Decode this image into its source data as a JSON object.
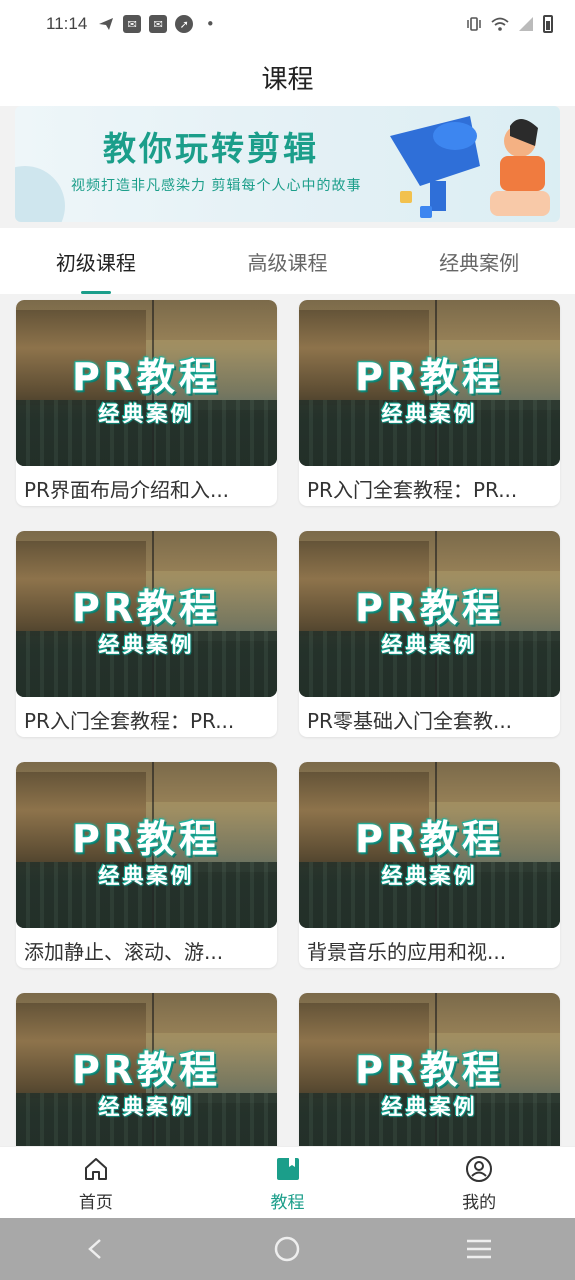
{
  "status_bar": {
    "time": "11:14",
    "left_icons": [
      "send-icon",
      "mail-icon",
      "mail-icon",
      "compass-icon",
      "dot-icon"
    ],
    "right_icons": [
      "vibrate-icon",
      "wifi-icon",
      "signal-icon",
      "battery-icon"
    ]
  },
  "header": {
    "title": "课程"
  },
  "banner": {
    "title": "教你玩转剪辑",
    "subtitle": "视频打造非凡感染力    剪辑每个人心中的故事"
  },
  "tabs": [
    {
      "label": "初级课程",
      "active": true
    },
    {
      "label": "高级课程",
      "active": false
    },
    {
      "label": "经典案例",
      "active": false
    }
  ],
  "thumb": {
    "title": "PR教程",
    "subtitle": "经典案例"
  },
  "courses": [
    {
      "title": "PR界面布局介绍和入..."
    },
    {
      "title": "PR入门全套教程：PR..."
    },
    {
      "title": "PR入门全套教程：PR..."
    },
    {
      "title": "PR零基础入门全套教..."
    },
    {
      "title": "添加静止、滚动、游..."
    },
    {
      "title": "背景音乐的应用和视..."
    },
    {
      "title": ""
    },
    {
      "title": ""
    }
  ],
  "bottom_nav": [
    {
      "label": "首页",
      "icon": "home-icon",
      "active": false
    },
    {
      "label": "教程",
      "icon": "book-icon",
      "active": true
    },
    {
      "label": "我的",
      "icon": "profile-icon",
      "active": false
    }
  ],
  "colors": {
    "accent": "#1b9e8a",
    "background": "#f2f2f2",
    "sys_nav": "#a8a8a8"
  }
}
